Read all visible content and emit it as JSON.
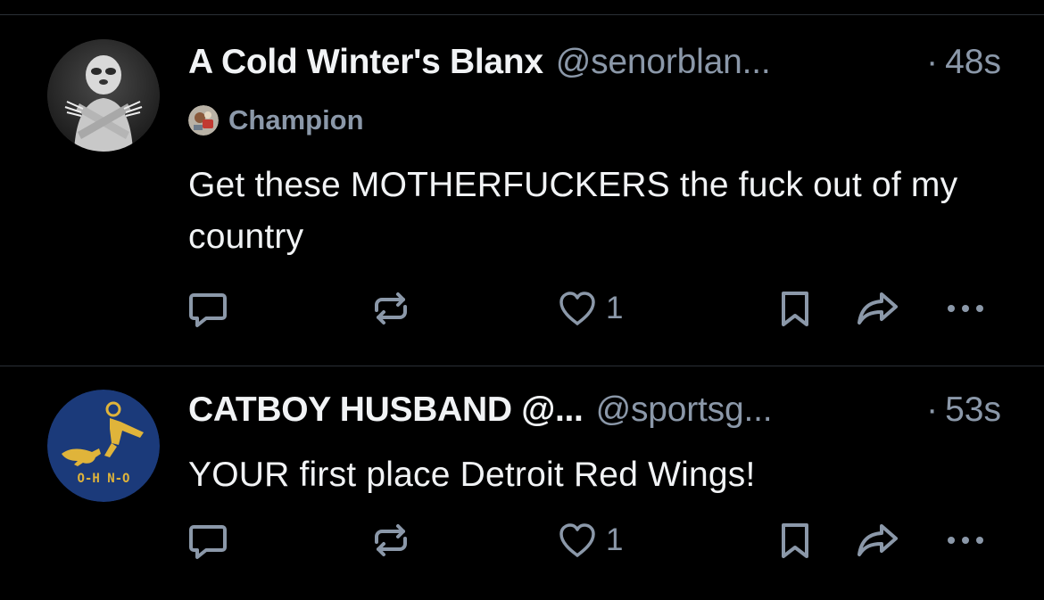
{
  "colors": {
    "background": "#000000",
    "text_primary": "#f1f3f5",
    "text_secondary": "#8b98a9",
    "divider": "#2a2f36"
  },
  "posts": [
    {
      "display_name": "A Cold Winter's Blanx",
      "handle": "@senorblan...",
      "dot": "·",
      "time": "48s",
      "badge": {
        "icon": "champion-badge-icon",
        "label": "Champion"
      },
      "avatar": "sloth-claws-avatar",
      "text": "Get these MOTHERFUCKERS the fuck out of my country",
      "actions": {
        "reply_icon": "reply-icon",
        "repost_icon": "repost-icon",
        "like_icon": "heart-icon",
        "like_count": "1",
        "save_icon": "bookmark-icon",
        "share_icon": "share-icon",
        "more_icon": "more-icon"
      }
    },
    {
      "display_name": "CATBOY HUSBAND @...",
      "handle": "@sportsg...",
      "dot": "·",
      "time": "53s",
      "avatar": "o-h-n-o-logo-avatar",
      "avatar_text": "O-H N-O",
      "text": "YOUR first place Detroit Red Wings!",
      "actions": {
        "reply_icon": "reply-icon",
        "repost_icon": "repost-icon",
        "like_icon": "heart-icon",
        "like_count": "1",
        "save_icon": "bookmark-icon",
        "share_icon": "share-icon",
        "more_icon": "more-icon"
      }
    }
  ]
}
